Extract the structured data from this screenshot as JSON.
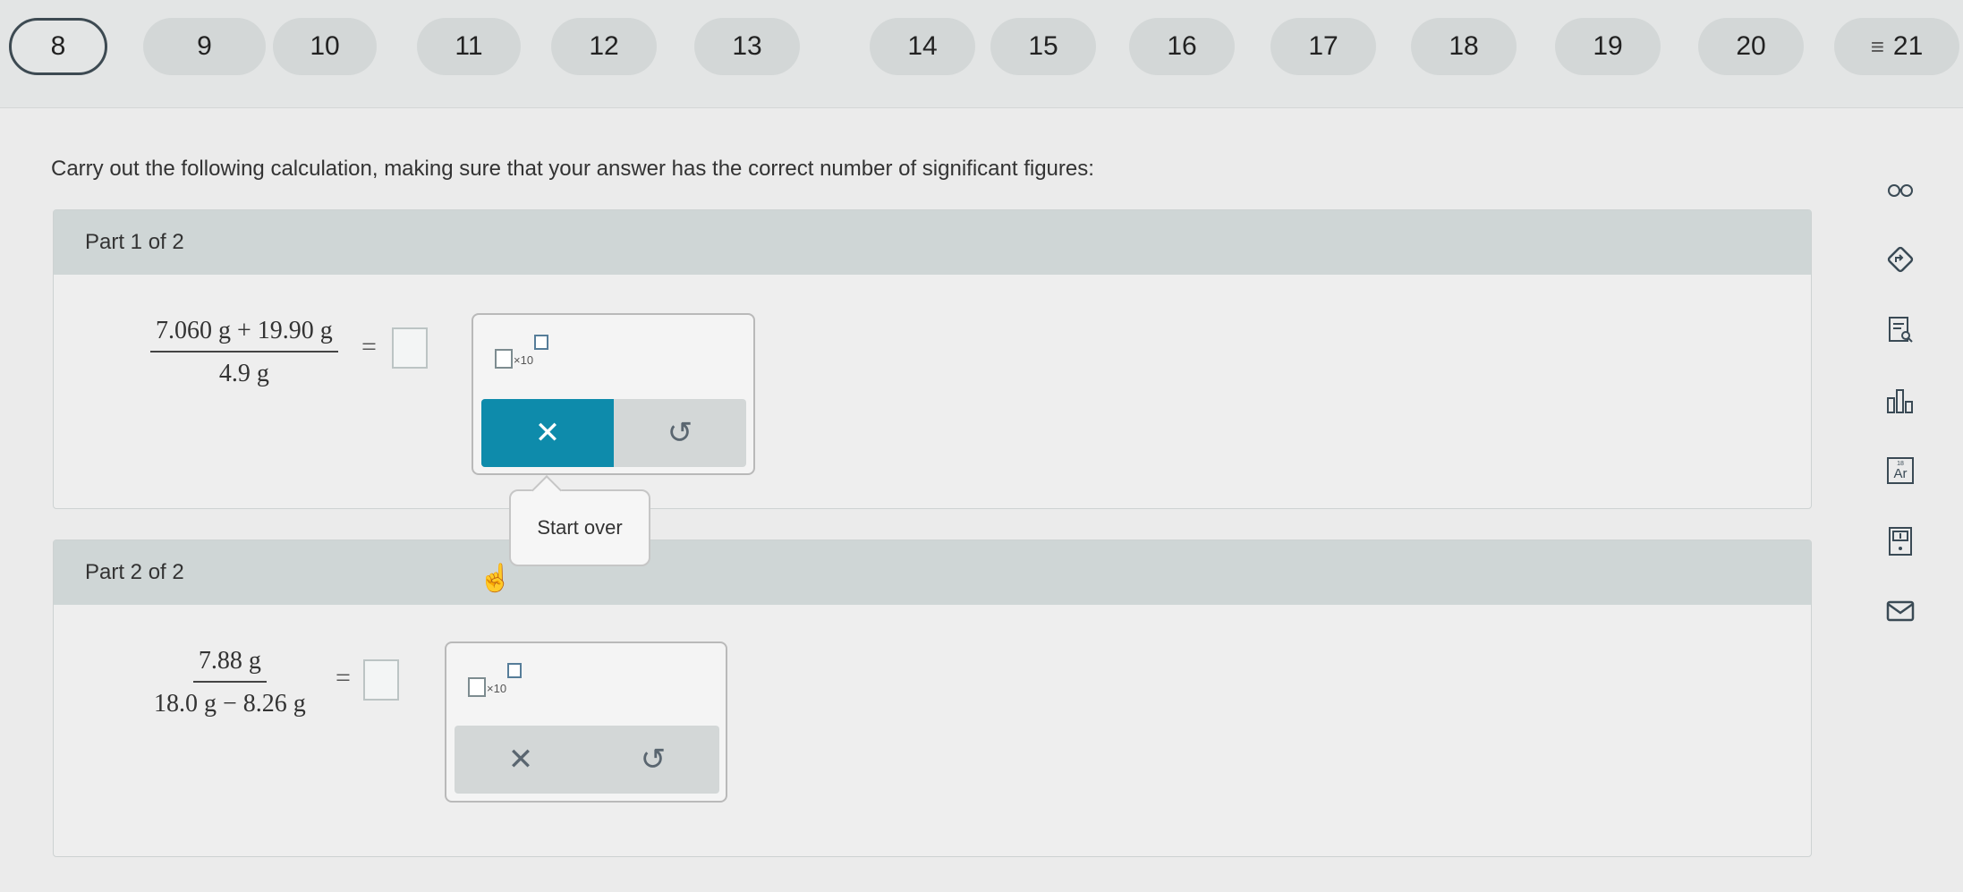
{
  "nav": {
    "questions": [
      "8",
      "9",
      "10",
      "11",
      "12",
      "13",
      "14",
      "15",
      "16",
      "17",
      "18",
      "19",
      "20"
    ],
    "current": "8",
    "menu_label": "21",
    "menu_icon": "menu-lines-icon"
  },
  "prompt": "Carry out the following calculation, making sure that your answer has the correct number of significant figures:",
  "parts": [
    {
      "title": "Part 1 of 2",
      "numerator": "7.060 g + 19.90 g",
      "denominator": "4.9 g",
      "equals": "=",
      "x10": "×10"
    },
    {
      "title": "Part 2 of 2",
      "numerator": "7.88 g",
      "denominator": "18.0 g − 8.26 g",
      "equals": "=",
      "x10": "×10"
    }
  ],
  "buttons": {
    "clear_symbol": "✕",
    "undo_symbol": "↺"
  },
  "tooltip": "Start over",
  "toolbar_icons": [
    "glasses-icon",
    "compass-arrow-icon",
    "notes-search-icon",
    "bar-chart-icon",
    "periodic-element-icon",
    "calculator-icon",
    "mail-icon"
  ],
  "toolbar": {
    "element_symbol": "Ar",
    "element_number": "18"
  },
  "colors": {
    "accent": "#0e8bab",
    "header_band": "#cfd6d6"
  }
}
